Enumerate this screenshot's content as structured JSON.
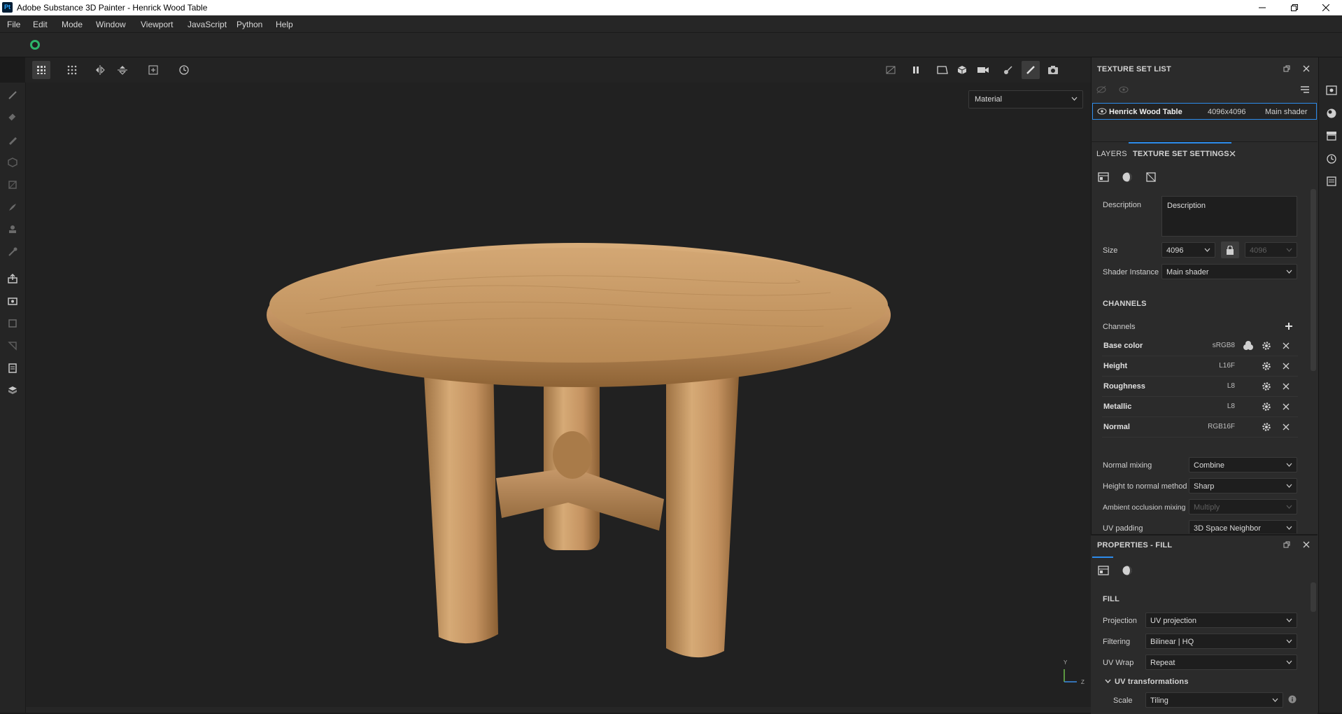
{
  "app": {
    "icon_text": "Pt",
    "title": "Adobe Substance 3D Painter - Henrick Wood Table"
  },
  "menu": [
    "File",
    "Edit",
    "Mode",
    "Window",
    "Viewport",
    "JavaScript",
    "Python",
    "Help"
  ],
  "viewport": {
    "display_mode": "Material"
  },
  "texture_set_list": {
    "title": "TEXTURE SET LIST",
    "item": {
      "name": "Henrick Wood Table",
      "resolution": "4096x4096",
      "shader": "Main shader"
    }
  },
  "tabs": {
    "layers": "LAYERS",
    "texture_set_settings": "TEXTURE SET SETTINGS"
  },
  "tss": {
    "description_label": "Description",
    "description_value": "Description",
    "size_label": "Size",
    "size_value": "4096",
    "size_value_locked": "4096",
    "shader_instance_label": "Shader Instance",
    "shader_instance_value": "Main shader",
    "channels_header": "CHANNELS",
    "channels_label": "Channels",
    "channels": [
      {
        "name": "Base color",
        "format": "sRGB8"
      },
      {
        "name": "Height",
        "format": "L16F"
      },
      {
        "name": "Roughness",
        "format": "L8"
      },
      {
        "name": "Metallic",
        "format": "L8"
      },
      {
        "name": "Normal",
        "format": "RGB16F"
      }
    ],
    "normal_mixing_label": "Normal mixing",
    "normal_mixing_value": "Combine",
    "height_to_normal_label": "Height to normal method",
    "height_to_normal_value": "Sharp",
    "ao_mixing_label": "Ambient occlusion mixing",
    "ao_mixing_value": "Multiply",
    "uv_padding_label": "UV padding",
    "uv_padding_value": "3D Space Neighbor"
  },
  "properties": {
    "title": "PROPERTIES - FILL",
    "section": "FILL",
    "projection_label": "Projection",
    "projection_value": "UV projection",
    "filtering_label": "Filtering",
    "filtering_value": "Bilinear | HQ",
    "uvwrap_label": "UV Wrap",
    "uvwrap_value": "Repeat",
    "uvtrans_label": "UV transformations",
    "scale_label": "Scale",
    "scale_value": "Tiling"
  },
  "gizmo": {
    "y": "Y",
    "z": "Z"
  },
  "colors": {
    "accent": "#2d8ceb",
    "panel": "#2b2b2b",
    "background": "#212121",
    "wood": "#c8955a"
  }
}
